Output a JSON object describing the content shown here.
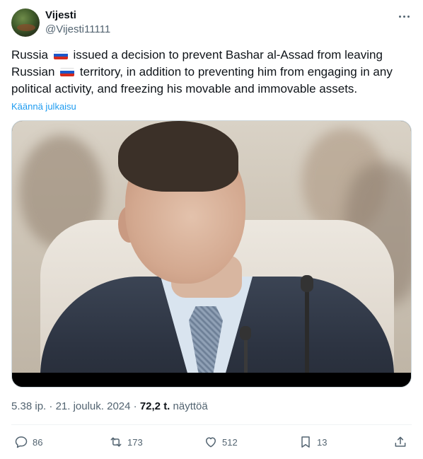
{
  "author": {
    "display_name": "Vijesti",
    "handle": "@Vijesti11111"
  },
  "tweet": {
    "text_part1": "Russia",
    "text_part2": "issued a decision to prevent Bashar al-Assad from leaving Russian",
    "text_part3": "territory, in addition to preventing him from engaging in any political activity, and freezing his movable and immovable assets.",
    "translate_label": "Käännä julkaisu",
    "flag_icon": "russia-flag-emoji",
    "image_description_icon": "photo"
  },
  "meta": {
    "time": "5.38 ip.",
    "separator": "·",
    "date": "21. jouluk. 2024",
    "views_count": "72,2 t.",
    "views_label": "näyttöä"
  },
  "actions": {
    "replies": "86",
    "reposts": "173",
    "likes": "512",
    "bookmarks": "13"
  },
  "colors": {
    "link": "#1d9bf0",
    "secondary_text": "#536471",
    "primary_text": "#0f1419",
    "border": "#cfd9de"
  }
}
